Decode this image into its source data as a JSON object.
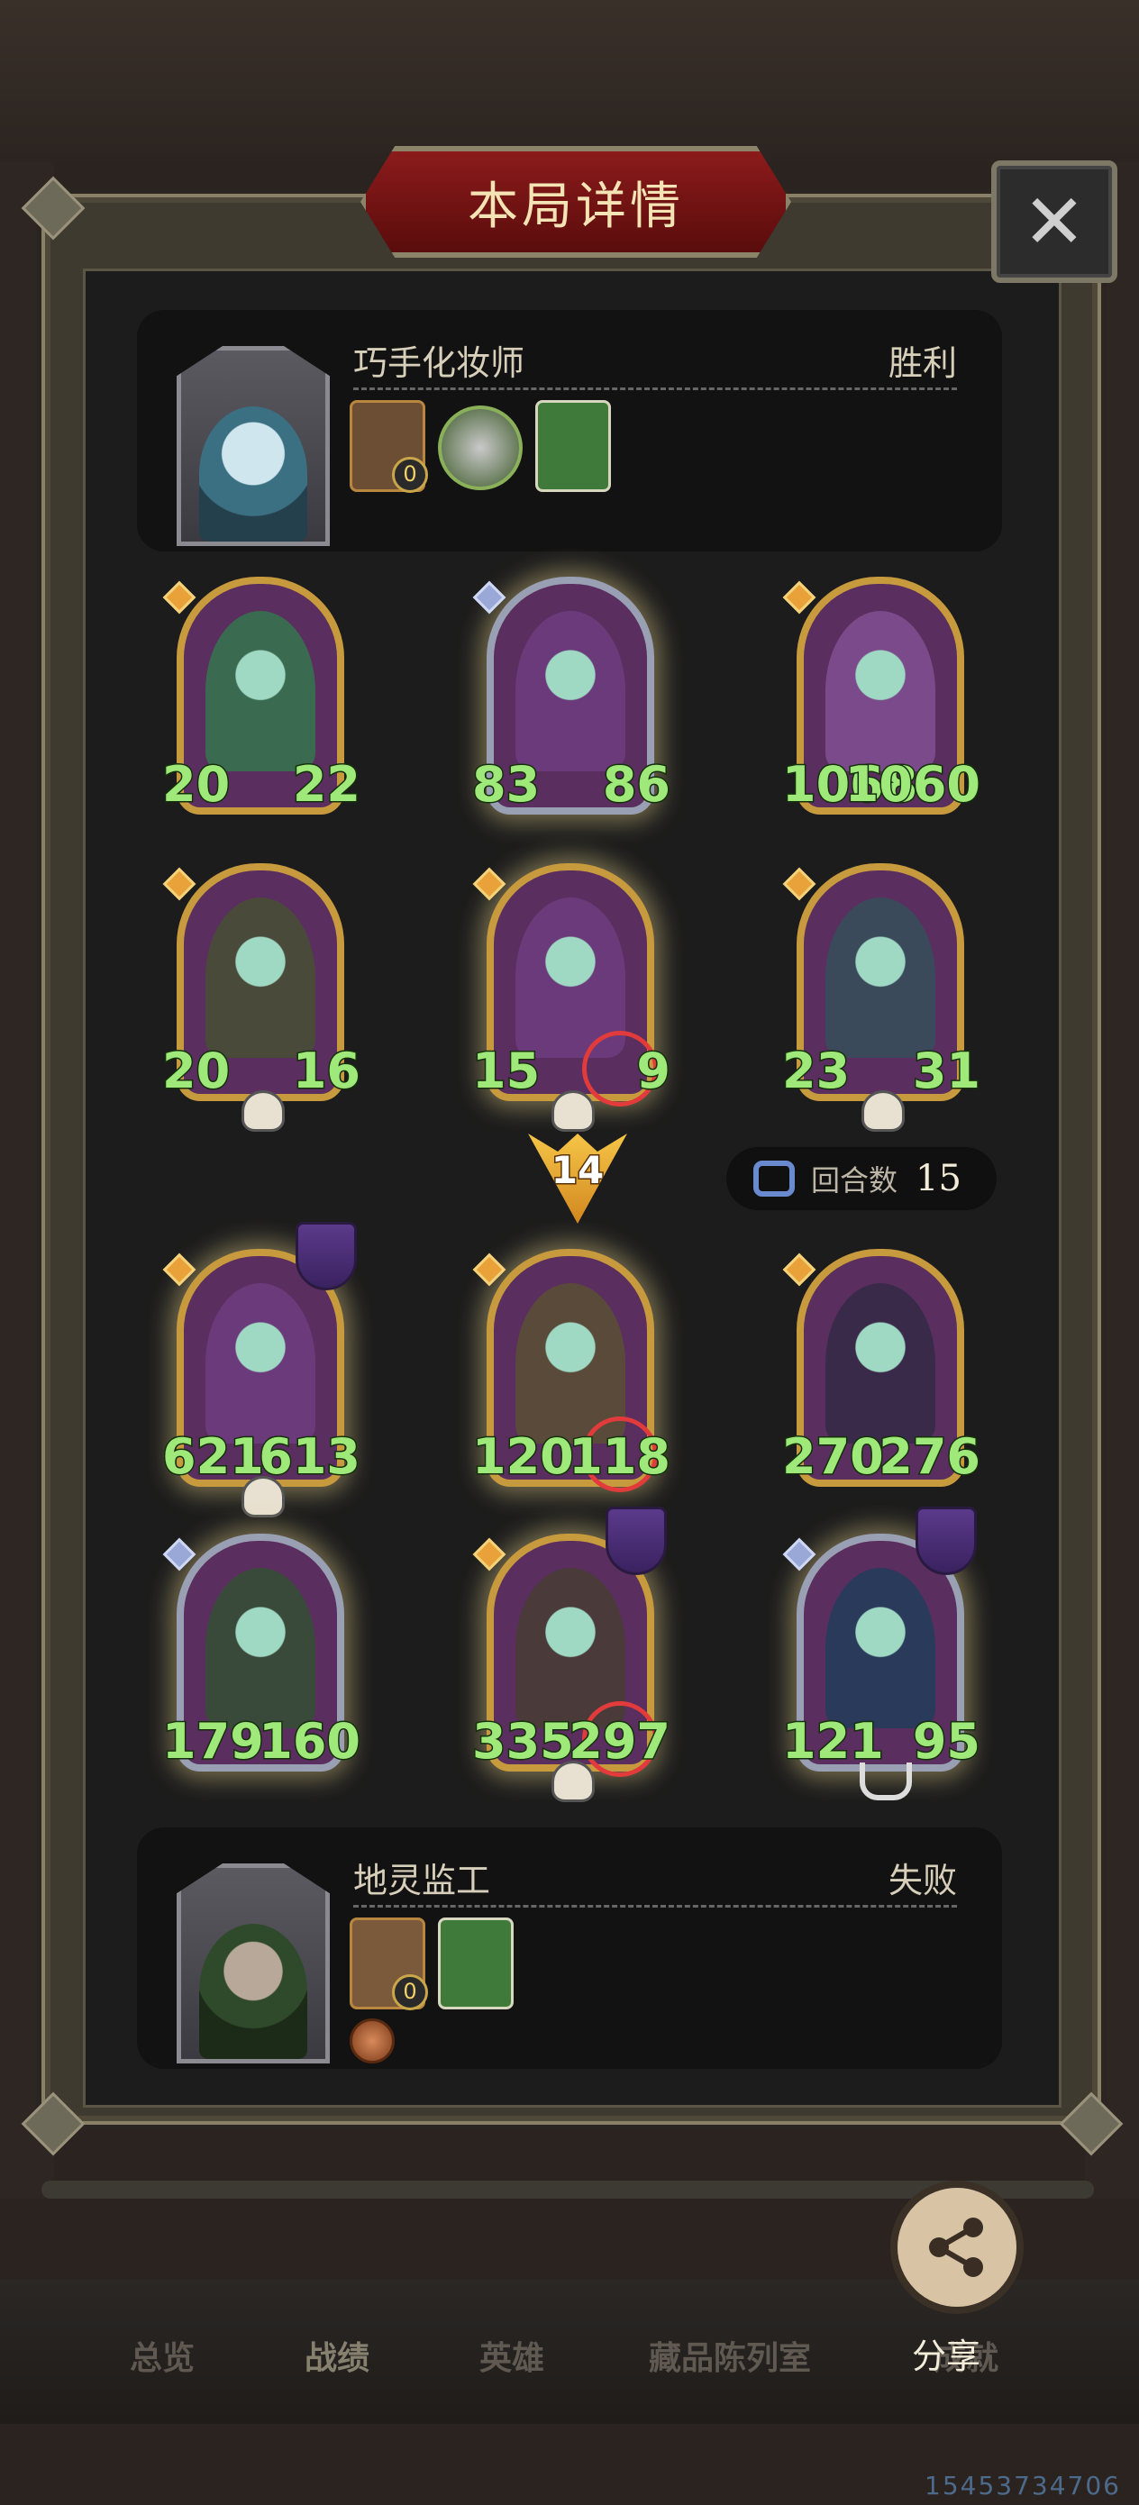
{
  "title": "本局详情",
  "close_label": "✕",
  "player_top": {
    "name": "巧手化妆师",
    "result": "胜利",
    "items": [
      {
        "icon": "portrait-card-icon",
        "count": "0"
      },
      {
        "icon": "creature-orb-icon"
      },
      {
        "icon": "green-book-icon"
      }
    ]
  },
  "player_bottom": {
    "name": "地灵监工",
    "result": "失败",
    "items": [
      {
        "icon": "door-card-icon",
        "count": "0"
      },
      {
        "icon": "green-book-icon"
      },
      {
        "icon": "copper-coin-icon"
      }
    ]
  },
  "top_board": [
    {
      "atk": "20",
      "hp": "22",
      "color": "#3a6a50"
    },
    {
      "atk": "83",
      "hp": "86",
      "color": "#6a3a7a"
    },
    {
      "atk": "1068",
      "hp": "1060",
      "color": "#7a4a8a"
    },
    {
      "atk": "20",
      "hp": "16",
      "color": "#4a4a3a"
    },
    {
      "atk": "15",
      "hp": "9",
      "color": "#6a3a7a"
    },
    {
      "atk": "23",
      "hp": "31",
      "color": "#3a4a5a"
    }
  ],
  "round_marker": "14",
  "turns": {
    "label": "回合数",
    "value": "15"
  },
  "bottom_board": [
    {
      "atk": "621",
      "hp": "613",
      "color": "#6a3a7a"
    },
    {
      "atk": "120",
      "hp": "118",
      "color": "#5a4a3a"
    },
    {
      "atk": "270",
      "hp": "276",
      "color": "#3a2a4a"
    },
    {
      "atk": "179",
      "hp": "160",
      "color": "#3a4a3a"
    },
    {
      "atk": "335",
      "hp": "297",
      "color": "#4a3a3a"
    },
    {
      "atk": "121",
      "hp": "95",
      "color": "#2a3a5a"
    }
  ],
  "nav": [
    "总览",
    "战绩",
    "英雄",
    "藏品陈列室",
    "成就"
  ],
  "share_label": "分享",
  "uid": "15453734706"
}
